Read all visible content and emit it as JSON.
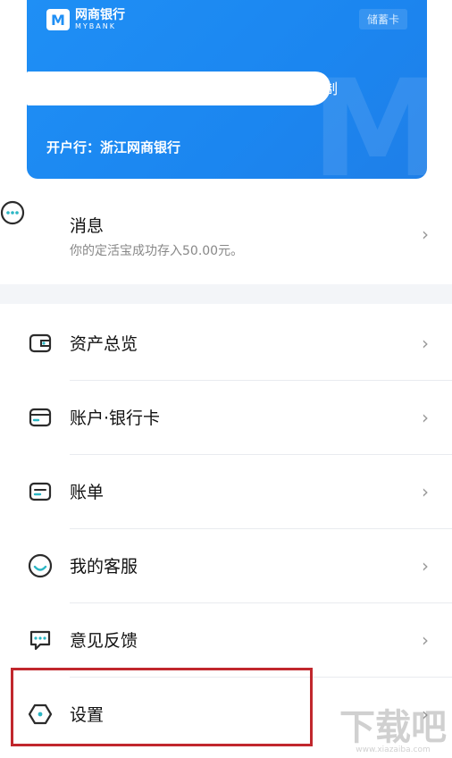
{
  "card": {
    "brand_cn": "网商银行",
    "brand_en": "MYBANK",
    "logo_letter": "M",
    "type_label": "储蓄卡",
    "copy_label": "复制",
    "bank_line": "开户行：浙江网商银行"
  },
  "message": {
    "title": "消息",
    "subtitle": "你的定活宝成功存入50.00元。",
    "icon": "chat-dots-icon"
  },
  "menu": [
    {
      "label": "资产总览",
      "icon": "wallet-icon"
    },
    {
      "label": "账户·银行卡",
      "icon": "bank-card-icon"
    },
    {
      "label": "账单",
      "icon": "bill-icon"
    },
    {
      "label": "我的客服",
      "icon": "smile-icon"
    },
    {
      "label": "意见反馈",
      "icon": "feedback-icon"
    },
    {
      "label": "设置",
      "icon": "settings-hexagon-icon"
    }
  ],
  "chevron": "›",
  "watermark": {
    "big": "下载吧",
    "small": "www.xiazaiba.com"
  },
  "colors": {
    "accent": "#1f8ff5",
    "highlight": "#c1272d",
    "icon_teal": "#2bb6c4"
  }
}
